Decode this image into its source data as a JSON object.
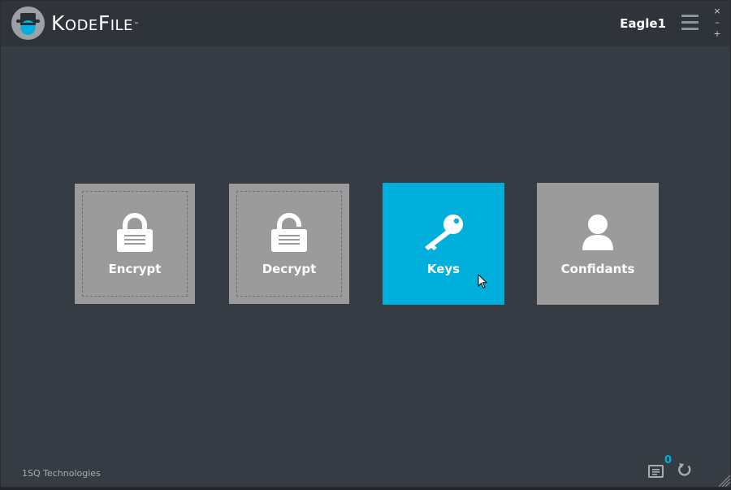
{
  "header": {
    "brand": {
      "first": "K",
      "part1": "ODE",
      "second": "F",
      "part2": "ILE",
      "tm": "™"
    },
    "username": "Eagle1",
    "window_controls": {
      "close": "×",
      "minimize": "–",
      "maximize": "+"
    }
  },
  "tiles": [
    {
      "label": "Encrypt",
      "icon": "lock-icon"
    },
    {
      "label": "Decrypt",
      "icon": "unlock-icon"
    },
    {
      "label": "Keys",
      "icon": "key-icon"
    },
    {
      "label": "Confidants",
      "icon": "person-icon"
    }
  ],
  "footer": {
    "company": "1SQ Technologies",
    "notification_count": "0"
  },
  "colors": {
    "accent": "#00afdb",
    "background": "#363c44",
    "titlebar": "#2f343b",
    "tile": "#9b9b9b"
  }
}
